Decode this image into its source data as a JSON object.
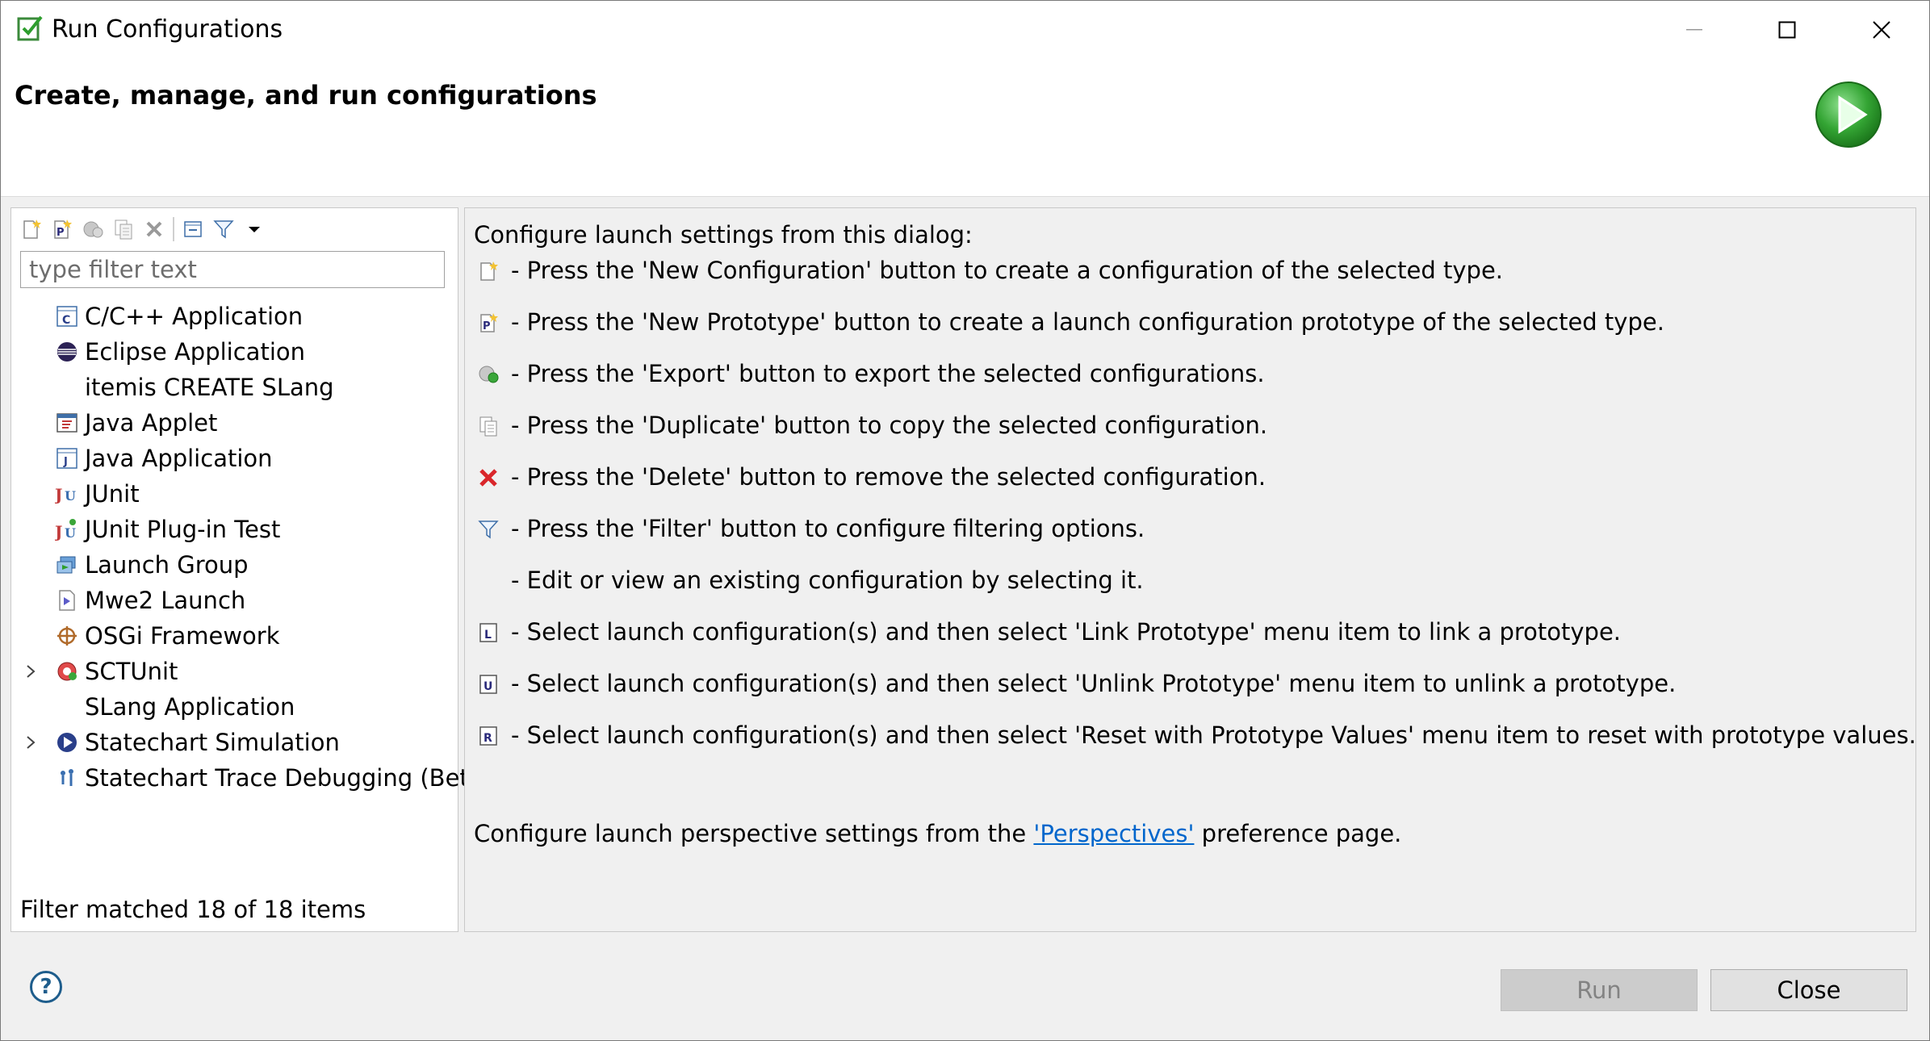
{
  "window": {
    "title": "Run Configurations"
  },
  "header": {
    "title": "Create, manage, and run configurations"
  },
  "toolbar": {
    "items": [
      "new-configuration-icon",
      "new-prototype-icon",
      "export-icon",
      "duplicate-icon",
      "delete-icon",
      "collapse-all-icon",
      "filter-icon",
      "view-menu-dropdown-icon"
    ]
  },
  "filter": {
    "placeholder": "type filter text",
    "status": "Filter matched 18 of 18 items"
  },
  "tree": {
    "items": [
      {
        "label": "C/C++ Application",
        "icon": "c-app-icon",
        "expandable": false
      },
      {
        "label": "Eclipse Application",
        "icon": "eclipse-icon",
        "expandable": false
      },
      {
        "label": "itemis CREATE SLang",
        "icon": "",
        "expandable": false
      },
      {
        "label": "Java Applet",
        "icon": "java-applet-icon",
        "expandable": false
      },
      {
        "label": "Java Application",
        "icon": "java-app-icon",
        "expandable": false
      },
      {
        "label": "JUnit",
        "icon": "junit-icon",
        "expandable": false
      },
      {
        "label": "JUnit Plug-in Test",
        "icon": "junit-plugin-icon",
        "expandable": false
      },
      {
        "label": "Launch Group",
        "icon": "launch-group-icon",
        "expandable": false
      },
      {
        "label": "Mwe2 Launch",
        "icon": "mwe2-icon",
        "expandable": false
      },
      {
        "label": "OSGi Framework",
        "icon": "osgi-icon",
        "expandable": false
      },
      {
        "label": "SCTUnit",
        "icon": "sctunit-icon",
        "expandable": true
      },
      {
        "label": "SLang Application",
        "icon": "",
        "expandable": false
      },
      {
        "label": "Statechart Simulation",
        "icon": "statechart-sim-icon",
        "expandable": true
      },
      {
        "label": "Statechart Trace Debugging (Beta)",
        "icon": "trace-debug-icon",
        "expandable": false
      }
    ]
  },
  "info": {
    "intro": "Configure launch settings from this dialog:",
    "rows": [
      {
        "icon": "new-configuration-icon",
        "text": "- Press the 'New Configuration' button to create a configuration of the selected type."
      },
      {
        "icon": "new-prototype-icon",
        "text": "- Press the 'New Prototype' button to create a launch configuration prototype of the selected type."
      },
      {
        "icon": "export-icon",
        "text": "- Press the 'Export' button to export the selected configurations."
      },
      {
        "icon": "duplicate-icon",
        "text": "- Press the 'Duplicate' button to copy the selected configuration."
      },
      {
        "icon": "delete-icon",
        "text": "- Press the 'Delete' button to remove the selected configuration."
      },
      {
        "icon": "filter-icon",
        "text": "- Press the 'Filter' button to configure filtering options."
      },
      {
        "icon": "",
        "text": "- Edit or view an existing configuration by selecting it."
      },
      {
        "icon": "link-prototype-icon",
        "text": "- Select launch configuration(s) and then select 'Link Prototype' menu item to link a prototype."
      },
      {
        "icon": "unlink-prototype-icon",
        "text": "- Select launch configuration(s) and then select 'Unlink Prototype' menu item to unlink a prototype."
      },
      {
        "icon": "reset-prototype-icon",
        "text": "- Select launch configuration(s) and then select 'Reset with Prototype Values' menu item to reset with prototype values."
      }
    ],
    "perspectives_prefix": "Configure launch perspective settings from the ",
    "perspectives_link": "'Perspectives'",
    "perspectives_suffix": " preference page."
  },
  "buttons": {
    "run": "Run",
    "close": "Close",
    "help": "?"
  },
  "colors": {
    "link": "#0066cc",
    "run_icon": "#3aa63a",
    "delete_icon": "#d9262b"
  }
}
